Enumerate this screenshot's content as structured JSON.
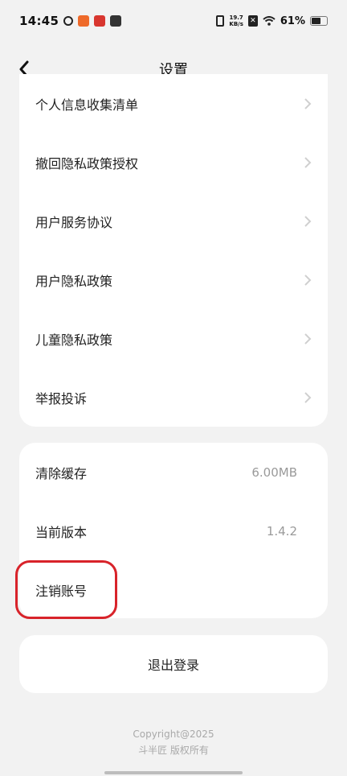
{
  "status_bar": {
    "time": "14:45",
    "speed_top": "19.7",
    "speed_bottom": "KB/s",
    "battery_percent": "61%"
  },
  "nav": {
    "title": "设置",
    "back_icon": "chevron-left-icon"
  },
  "card1": {
    "items": [
      {
        "label": "个人信息收集清单"
      },
      {
        "label": "撤回隐私政策授权"
      },
      {
        "label": "用户服务协议"
      },
      {
        "label": "用户隐私政策"
      },
      {
        "label": "儿童隐私政策"
      },
      {
        "label": "举报投诉"
      }
    ]
  },
  "card2": {
    "clear_cache": {
      "label": "清除缓存",
      "value": "6.00MB"
    },
    "version": {
      "label": "当前版本",
      "value": "1.4.2"
    },
    "delete_account": {
      "label": "注销账号"
    }
  },
  "logout": {
    "label": "退出登录"
  },
  "footer": {
    "copyright": "Copyright@2025",
    "owner": "斗半匠 版权所有"
  },
  "colors": {
    "highlight": "#d8232a",
    "background": "#f2f2f2"
  }
}
